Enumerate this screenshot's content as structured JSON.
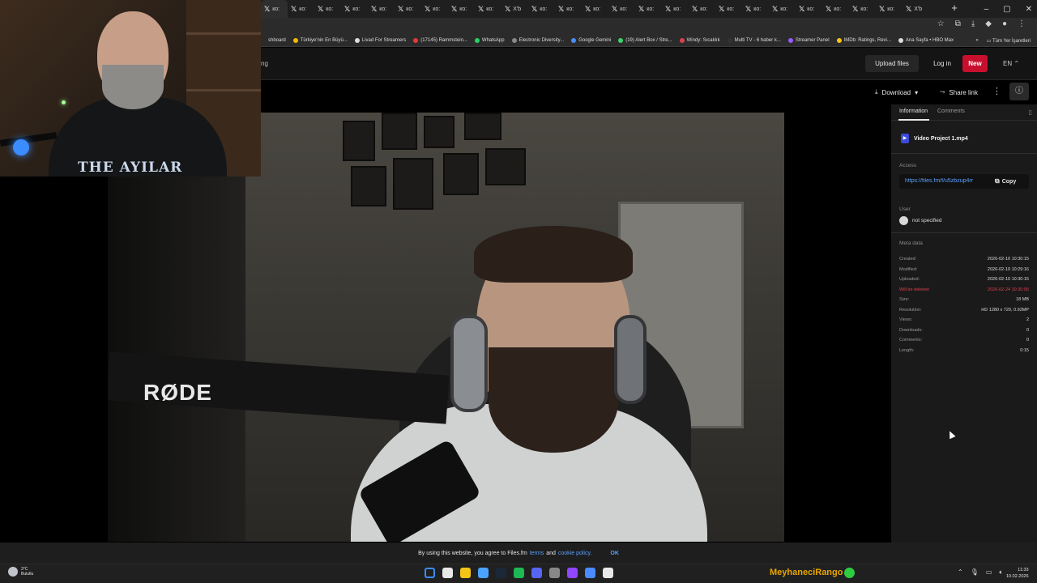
{
  "browser": {
    "tabs": [
      "ко:",
      "ко:",
      "ко:",
      "ко:",
      "ко:",
      "ко:",
      "ко:",
      "ко:",
      "ко:",
      "X'b",
      "ко:",
      "ко:",
      "ко:",
      "ко:",
      "ко:",
      "ко:",
      "ко:",
      "ко:",
      "ко:",
      "ко:",
      "ко:",
      "ко:",
      "ко:",
      "ко:",
      "X'b"
    ],
    "new_tab": "+",
    "window_controls": [
      "–",
      "▢",
      "✕"
    ],
    "bookmarks": [
      {
        "label": "shboard",
        "color": "#2b2b2b"
      },
      {
        "label": "Türkiye'nin En Büyü...",
        "color": "#f5b800"
      },
      {
        "label": "Livad For Streamers",
        "color": "#dddddd"
      },
      {
        "label": "(17145) Rammstein...",
        "color": "#e53935"
      },
      {
        "label": "WhatsApp",
        "color": "#25d366"
      },
      {
        "label": "Electronic Diversity...",
        "color": "#888888"
      },
      {
        "label": "Google Gemini",
        "color": "#4a8cff"
      },
      {
        "label": "(19) Alert Box / Stre...",
        "color": "#3bd36b"
      },
      {
        "label": "Windy: Sıcaklık",
        "color": "#d9414f"
      },
      {
        "label": "Multi TV - 6 haber k...",
        "color": "#333333"
      },
      {
        "label": "Streamer Panel",
        "color": "#9b59ff"
      },
      {
        "label": "IMDb: Ratings, Revi...",
        "color": "#f5c518"
      },
      {
        "label": "Ana Sayfa • HBO Max",
        "color": "#dddddd"
      }
    ],
    "bookmarks_more": "»",
    "all_bookmarks": "Tüm Yer İşaretleri"
  },
  "header": {
    "fragment": "ng",
    "upload": "Upload files",
    "login": "Log in",
    "new": "New",
    "lang": "EN ⌃"
  },
  "actions": {
    "download": "Download",
    "share": "Share link",
    "more": "⋮",
    "info": "ⓘ"
  },
  "panel": {
    "tab_info": "Information",
    "tab_comments": "Comments",
    "file_name": "Video Project 1.mp4",
    "access_label": "Access",
    "access_link": "https://files.fm/f/u5zbzup4rr",
    "copy": "Copy",
    "user_label": "User",
    "user_value": "not specified",
    "meta_label": "Meta data",
    "meta": [
      {
        "k": "Created:",
        "v": "2026-02-10 10:30:15",
        "danger": false
      },
      {
        "k": "Modified:",
        "v": "2026-02-10 10:29:16",
        "danger": false
      },
      {
        "k": "Uploaded:",
        "v": "2026-02-10 10:30:15",
        "danger": false
      },
      {
        "k": "Will be deleted:",
        "v": "2026-02-24 10:30:05",
        "danger": true
      },
      {
        "k": "Size:",
        "v": "18 MB",
        "danger": false
      },
      {
        "k": "Resolution:",
        "v": "HD 1280 x 720, 0.92MP",
        "danger": false
      },
      {
        "k": "Views:",
        "v": "2",
        "danger": false
      },
      {
        "k": "Downloads:",
        "v": "0",
        "danger": false
      },
      {
        "k": "Comments:",
        "v": "0",
        "danger": false
      },
      {
        "k": "Length:",
        "v": "0:15",
        "danger": false
      }
    ]
  },
  "video": {
    "mic_brand": "RØDE"
  },
  "cookie": {
    "text": "By using this website, you agree to Files.fm",
    "terms": "terms",
    "and": "and",
    "policy": "cookie policy.",
    "ok": "OK"
  },
  "taskbar": {
    "temp": "3°C",
    "weather": "Bulutlu",
    "apps": [
      "#3a8cff",
      "#e8e8e8",
      "#f5c518",
      "#4aa3ff",
      "#1b2838",
      "#1db954",
      "#5865f2",
      "#888888",
      "#9146ff",
      "#4a8cff",
      "#e8e8e8"
    ],
    "streamer": "MeyhaneciRango",
    "time": "11:33",
    "date": "10.02.2026"
  },
  "webcam": {
    "shirt_text": "THE AYILAR"
  }
}
